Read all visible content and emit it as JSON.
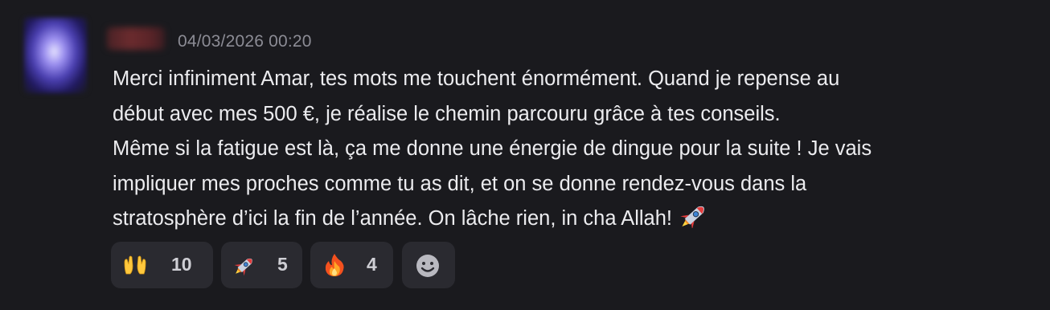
{
  "message": {
    "timestamp": "04/03/2026 00:20",
    "lines": [
      "Merci infiniment Amar, tes mots me touchent énormément. Quand je repense au",
      "début avec mes 500 €, je réalise le chemin parcouru grâce à tes conseils.",
      "Même si la fatigue est là, ça me donne une énergie de dingue pour la suite ! Je vais",
      "impliquer mes proches comme tu as dit, et on se donne rendez-vous dans la",
      "stratosphère d’ici la fin de l’année. On lâche rien, in cha Allah!"
    ],
    "trailing_emoji": "rocket-icon"
  },
  "reactions": [
    {
      "icon": "raised-hands-icon",
      "count": "10"
    },
    {
      "icon": "rocket-icon",
      "count": "5"
    },
    {
      "icon": "fire-icon",
      "count": "4"
    },
    {
      "icon": "add-reaction-icon"
    }
  ],
  "colors": {
    "background": "#1a1a1e",
    "text": "#ececef",
    "timestamp": "#8c8c95",
    "reaction_bg": "#2a2a30"
  }
}
